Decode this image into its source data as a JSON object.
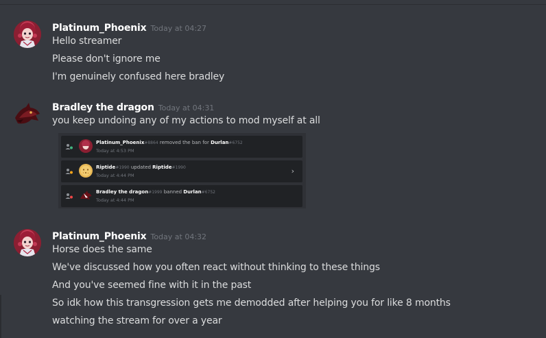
{
  "messages": [
    {
      "username": "Platinum_Phoenix",
      "timestamp": "Today at 04:27",
      "lines": [
        "Hello streamer",
        "Please don't ignore me",
        "I'm genuinely confused here bradley"
      ]
    },
    {
      "username": "Bradley the dragon",
      "timestamp": "Today at 04:31",
      "lines": [
        "you keep undoing any of my actions to mod myself at all"
      ]
    },
    {
      "username": "Platinum_Phoenix",
      "timestamp": "Today at 04:32",
      "lines": [
        "Horse does the same",
        "We've discussed how you often react without thinking to these things",
        "And you've seemed fine with it in the past",
        "So idk how this transgression gets me demodded after helping you for like 8 months",
        "watching the stream for over a year"
      ]
    }
  ],
  "audit_log": [
    {
      "actor": "Platinum_Phoenix",
      "actor_disc": "#8864",
      "action": " removed the ban for ",
      "target": "Durlan",
      "target_disc": "#6752",
      "time": "Today at 4:53 PM",
      "icon": "members-icon"
    },
    {
      "actor": "Riptide",
      "actor_disc": "#1990",
      "action": " updated ",
      "target": "Riptide",
      "target_disc": "#1990",
      "time": "Today at 4:44 PM",
      "icon": "members-icon",
      "chevron": "›"
    },
    {
      "actor": "Bradley the dragon",
      "actor_disc": "#1999",
      "action": " banned ",
      "target": "Durlan",
      "target_disc": "#6752",
      "time": "Today at 4:44 PM",
      "icon": "members-icon"
    }
  ],
  "colors": {
    "background": "#36393f",
    "username": "#ffffff",
    "timestamp": "#72767d",
    "text": "#dcddde",
    "audit_row_bg": "#202225"
  }
}
